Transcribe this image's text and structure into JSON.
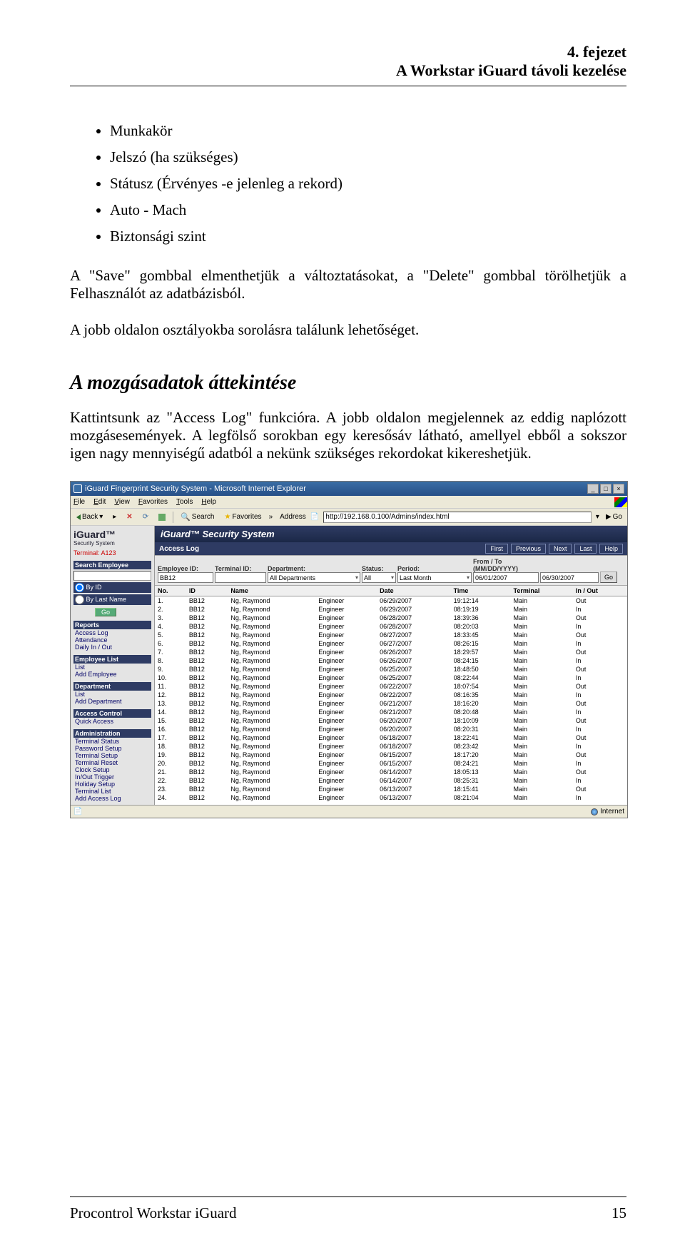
{
  "header": {
    "chapter": "4. fejezet",
    "subtitle": "A Workstar iGuard távoli kezelése"
  },
  "bullets": [
    "Munkakör",
    "Jelszó (ha szükséges)",
    "Státusz (Érvényes -e jelenleg a rekord)",
    "Auto - Mach",
    "Biztonsági szint"
  ],
  "para1": "A \"Save\" gombbal elmenthetjük a változtatásokat, a \"Delete\" gombbal törölhetjük a Felhasználót az adatbázisból.",
  "para2": "A jobb oldalon osztályokba sorolásra találunk lehetőséget.",
  "section_title": "A mozgásadatok áttekintése",
  "para3": "Kattintsunk az \"Access Log\" funkcióra. A jobb oldalon megjelennek az eddig naplózott mozgásesemények. A legfölső sorokban egy keresősáv látható, amellyel ebből a sokszor igen nagy mennyiségű adatból a nekünk szükséges rekordokat kikereshetjük.",
  "ie": {
    "title": "iGuard Fingerprint Security System - Microsoft Internet Explorer",
    "menus": [
      "File",
      "Edit",
      "View",
      "Favorites",
      "Tools",
      "Help"
    ],
    "toolbar": {
      "back": "Back",
      "search": "Search",
      "favorites": "Favorites",
      "address_label": "Address",
      "address_value": "http://192.168.0.100/Admins/index.html",
      "go": "Go"
    },
    "sidebar": {
      "logo": "iGuard™",
      "logo_sub": "Security System",
      "terminal": "Terminal: A123",
      "search_employee": "Search Employee",
      "by_id": "By ID",
      "by_last": "By Last Name",
      "go": "Go",
      "reports": "Reports",
      "reports_items": [
        "Access Log",
        "Attendance",
        "Daily In / Out"
      ],
      "emp_list": "Employee List",
      "emp_items": [
        "List",
        "Add Employee"
      ],
      "dept": "Department",
      "dept_items": [
        "List",
        "Add Department"
      ],
      "access_ctrl": "Access Control",
      "access_items": [
        "Quick Access"
      ],
      "admin": "Administration",
      "admin_items": [
        "Terminal Status",
        "Password Setup",
        "Terminal Setup",
        "Terminal Reset",
        "Clock Setup",
        "In/Out Trigger",
        "Holiday Setup",
        "Terminal List",
        "Add Access Log"
      ]
    },
    "content": {
      "system_title": "iGuard™ Security System",
      "section": "Access Log",
      "nav": [
        "First",
        "Previous",
        "Next",
        "Last",
        "Help"
      ],
      "filters": {
        "emp_id_l": "Employee ID:",
        "emp_id_v": "BB12",
        "term_l": "Terminal ID:",
        "dept_l": "Department:",
        "dept_v": "All Departments",
        "status_l": "Status:",
        "status_v": "All",
        "period_l": "Period:",
        "period_v": "Last Month",
        "fromto_l": "From / To (MM/DD/YYYY)",
        "from_v": "06/01/2007",
        "to_v": "06/30/2007",
        "go": "Go"
      },
      "cols": [
        "No.",
        "ID",
        "Name",
        "",
        "Date",
        "Time",
        "Terminal",
        "In / Out"
      ],
      "rows": [
        [
          "1.",
          "BB12",
          "Ng, Raymond",
          "Engineer",
          "06/29/2007",
          "19:12:14",
          "Main",
          "Out"
        ],
        [
          "2.",
          "BB12",
          "Ng, Raymond",
          "Engineer",
          "06/29/2007",
          "08:19:19",
          "Main",
          "In"
        ],
        [
          "3.",
          "BB12",
          "Ng, Raymond",
          "Engineer",
          "06/28/2007",
          "18:39:36",
          "Main",
          "Out"
        ],
        [
          "4.",
          "BB12",
          "Ng, Raymond",
          "Engineer",
          "06/28/2007",
          "08:20:03",
          "Main",
          "In"
        ],
        [
          "5.",
          "BB12",
          "Ng, Raymond",
          "Engineer",
          "06/27/2007",
          "18:33:45",
          "Main",
          "Out"
        ],
        [
          "6.",
          "BB12",
          "Ng, Raymond",
          "Engineer",
          "06/27/2007",
          "08:26:15",
          "Main",
          "In"
        ],
        [
          "7.",
          "BB12",
          "Ng, Raymond",
          "Engineer",
          "06/26/2007",
          "18:29:57",
          "Main",
          "Out"
        ],
        [
          "8.",
          "BB12",
          "Ng, Raymond",
          "Engineer",
          "06/26/2007",
          "08:24:15",
          "Main",
          "In"
        ],
        [
          "9.",
          "BB12",
          "Ng, Raymond",
          "Engineer",
          "06/25/2007",
          "18:48:50",
          "Main",
          "Out"
        ],
        [
          "10.",
          "BB12",
          "Ng, Raymond",
          "Engineer",
          "06/25/2007",
          "08:22:44",
          "Main",
          "In"
        ],
        [
          "11.",
          "BB12",
          "Ng, Raymond",
          "Engineer",
          "06/22/2007",
          "18:07:54",
          "Main",
          "Out"
        ],
        [
          "12.",
          "BB12",
          "Ng, Raymond",
          "Engineer",
          "06/22/2007",
          "08:16:35",
          "Main",
          "In"
        ],
        [
          "13.",
          "BB12",
          "Ng, Raymond",
          "Engineer",
          "06/21/2007",
          "18:16:20",
          "Main",
          "Out"
        ],
        [
          "14.",
          "BB12",
          "Ng, Raymond",
          "Engineer",
          "06/21/2007",
          "08:20:48",
          "Main",
          "In"
        ],
        [
          "15.",
          "BB12",
          "Ng, Raymond",
          "Engineer",
          "06/20/2007",
          "18:10:09",
          "Main",
          "Out"
        ],
        [
          "16.",
          "BB12",
          "Ng, Raymond",
          "Engineer",
          "06/20/2007",
          "08:20:31",
          "Main",
          "In"
        ],
        [
          "17.",
          "BB12",
          "Ng, Raymond",
          "Engineer",
          "06/18/2007",
          "18:22:41",
          "Main",
          "Out"
        ],
        [
          "18.",
          "BB12",
          "Ng, Raymond",
          "Engineer",
          "06/18/2007",
          "08:23:42",
          "Main",
          "In"
        ],
        [
          "19.",
          "BB12",
          "Ng, Raymond",
          "Engineer",
          "06/15/2007",
          "18:17:20",
          "Main",
          "Out"
        ],
        [
          "20.",
          "BB12",
          "Ng, Raymond",
          "Engineer",
          "06/15/2007",
          "08:24:21",
          "Main",
          "In"
        ],
        [
          "21.",
          "BB12",
          "Ng, Raymond",
          "Engineer",
          "06/14/2007",
          "18:05:13",
          "Main",
          "Out"
        ],
        [
          "22.",
          "BB12",
          "Ng, Raymond",
          "Engineer",
          "06/14/2007",
          "08:25:31",
          "Main",
          "In"
        ],
        [
          "23.",
          "BB12",
          "Ng, Raymond",
          "Engineer",
          "06/13/2007",
          "18:15:41",
          "Main",
          "Out"
        ],
        [
          "24.",
          "BB12",
          "Ng, Raymond",
          "Engineer",
          "06/13/2007",
          "08:21:04",
          "Main",
          "In"
        ]
      ]
    },
    "status": {
      "zone": "Internet"
    }
  },
  "footer": {
    "left": "Procontrol Workstar iGuard",
    "right": "15"
  }
}
